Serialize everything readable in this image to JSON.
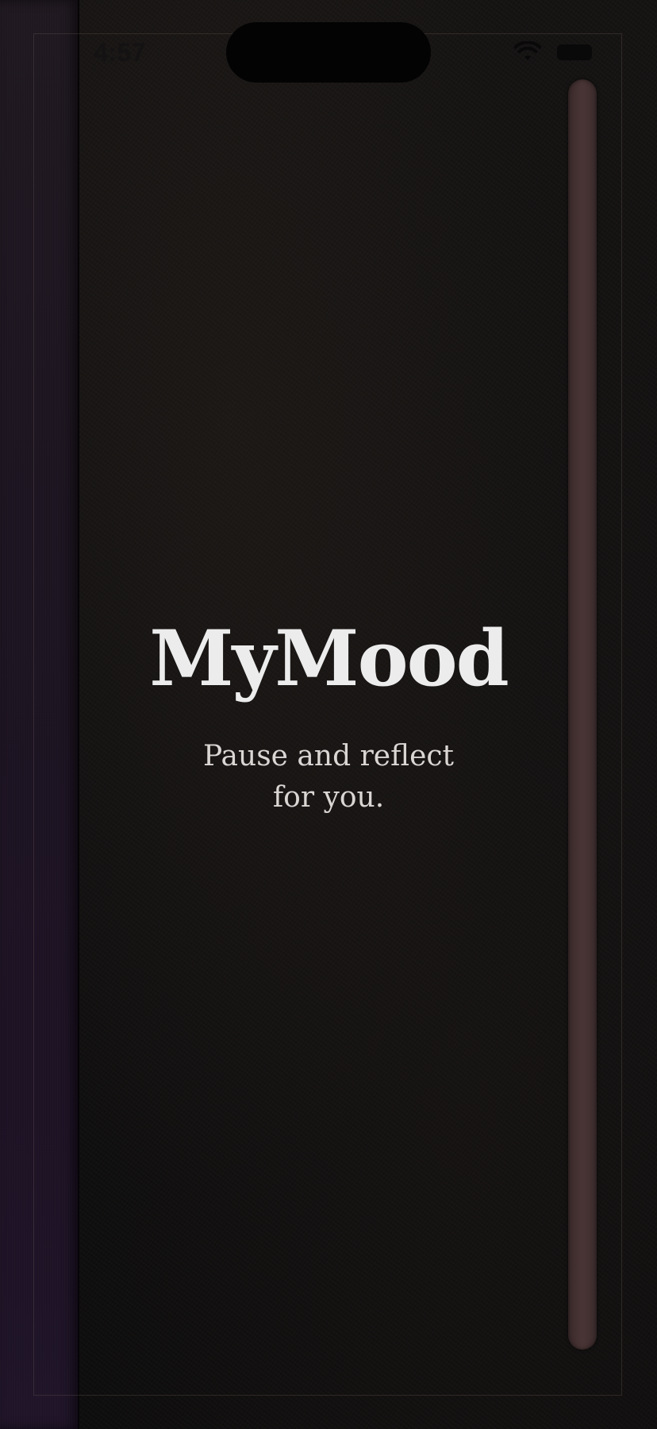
{
  "status_bar": {
    "time": "4:57",
    "wifi_icon": "wifi-icon",
    "battery_icon": "battery-icon"
  },
  "splash": {
    "title": "MyMood",
    "tagline_line1": "Pause and reflect",
    "tagline_line2": "for you."
  },
  "colors": {
    "background": "#121111",
    "spine": "#1d1224",
    "scroll_track": "#4a3536",
    "title": "#ececec",
    "tagline": "#d9d6d4"
  }
}
